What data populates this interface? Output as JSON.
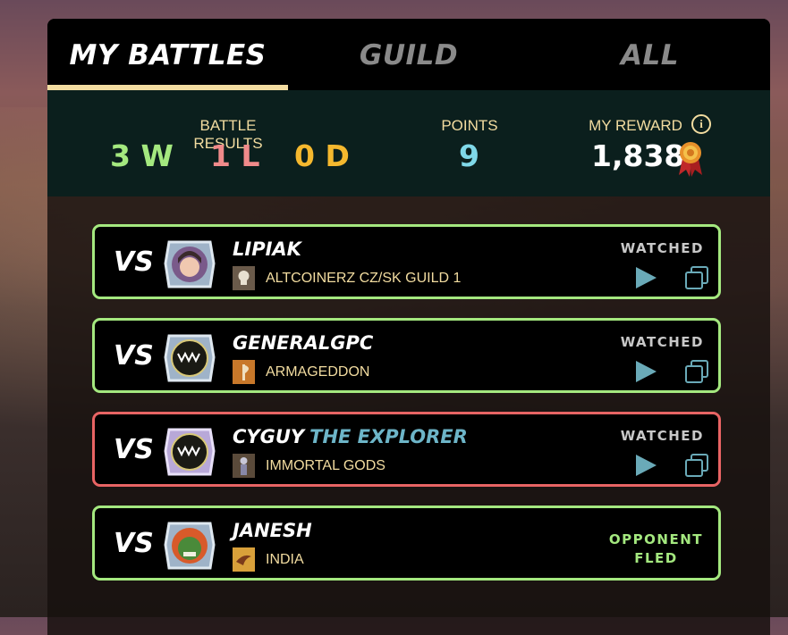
{
  "tabs": [
    {
      "label": "MY BATTLES",
      "active": true
    },
    {
      "label": "GUILD",
      "active": false
    },
    {
      "label": "ALL",
      "active": false
    }
  ],
  "summary": {
    "battle_results_label": "BATTLE RESULTS",
    "wins": "3 W",
    "losses": "1 L",
    "draws": "0 D",
    "points_label": "POINTS",
    "points": "9",
    "reward_label": "MY REWARD",
    "reward": "1,838",
    "info_icon": "i"
  },
  "battles": [
    {
      "vs": "VS",
      "name": "LIPIAK",
      "title": "",
      "guild": "ALTCOINERZ CZ/SK GUILD 1",
      "status": "WATCHED",
      "result": "win",
      "avatar_icon": "girl-avatar-icon",
      "guild_icon": "skull-banner-icon"
    },
    {
      "vs": "VS",
      "name": "GENERALGPC",
      "title": "",
      "guild": "ARMAGEDDON",
      "status": "WATCHED",
      "result": "win",
      "avatar_icon": "monster-mouth-avatar-icon",
      "guild_icon": "axe-banner-icon"
    },
    {
      "vs": "VS",
      "name": "CYGUY",
      "title": "THE EXPLORER",
      "guild": "IMMORTAL GODS",
      "status": "WATCHED",
      "result": "loss",
      "avatar_icon": "monster-mouth-avatar-icon",
      "guild_icon": "figure-banner-icon"
    },
    {
      "vs": "VS",
      "name": "JANESH",
      "title": "",
      "guild": "INDIA",
      "status_line1": "OPPONENT",
      "status_line2": "FLED",
      "result": "win",
      "avatar_icon": "orc-avatar-icon",
      "guild_icon": "bird-banner-icon"
    }
  ],
  "colors": {
    "win_border": "#a4e87f",
    "loss_border": "#e86464",
    "wins_text": "#a4e87f",
    "losses_text": "#f08a8a",
    "draws_text": "#f5b82e",
    "points_text": "#7fd8e8",
    "accent": "#f2dca0"
  }
}
